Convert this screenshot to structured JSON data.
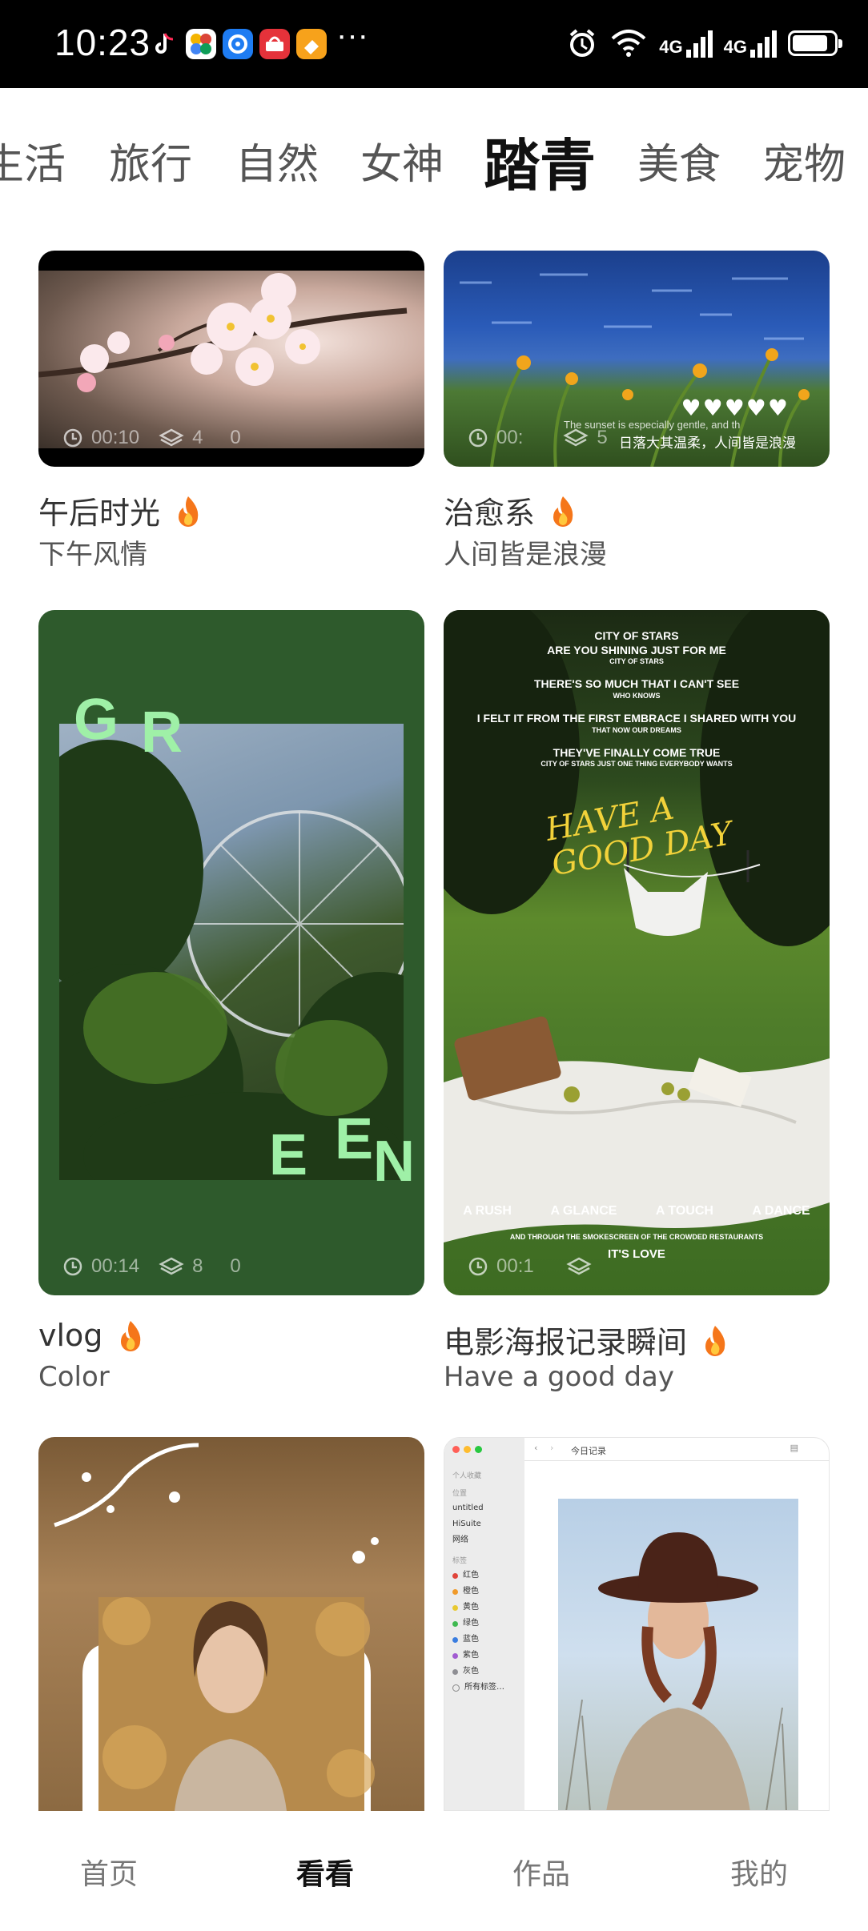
{
  "status_bar": {
    "time": "10:23",
    "more": "···",
    "net1": "4G",
    "net2": "4G",
    "battery_level": 0.85,
    "app_icons": [
      "tiktok-icon",
      "photos-icon",
      "browser-icon",
      "huawei-icon",
      "app-icon"
    ]
  },
  "tabs": [
    {
      "label": "生活"
    },
    {
      "label": "旅行"
    },
    {
      "label": "自然"
    },
    {
      "label": "女神"
    },
    {
      "label": "踏青",
      "active": true
    },
    {
      "label": "美食"
    },
    {
      "label": "宠物"
    }
  ],
  "cards": [
    {
      "title": "午后时光",
      "subtitle": "下午风情",
      "duration": "00:10",
      "layers": "4",
      "count": "0",
      "hot": true
    },
    {
      "title": "治愈系",
      "subtitle": "人间皆是浪漫",
      "duration": "00:",
      "layers": "5",
      "count": "",
      "hot": true,
      "overlay_text": "日落大其温柔，人间皆是浪漫",
      "overlay_small": "The sunset is especially gentle, and the world is romantic",
      "hearts": "♥♥♥♥♥"
    },
    {
      "title": "vlog",
      "subtitle": "Color",
      "duration": "00:14",
      "layers": "8",
      "count": "0",
      "hot": true,
      "letters": [
        "G",
        "R",
        "E",
        "E",
        "N"
      ]
    },
    {
      "title": "电影海报记录瞬间",
      "subtitle": "Have a good day",
      "duration": "00:1",
      "layers": "",
      "count": "",
      "hot": true,
      "poster_lines": [
        "CITY OF STARS",
        "ARE YOU SHINING JUST FOR ME",
        "CITY OF STARS",
        "THERE'S SO MUCH THAT I CAN'T SEE",
        "WHO KNOWS",
        "I FELT IT FROM THE FIRST EMBRACE I SHARED WITH YOU",
        "THAT NOW OUR DREAMS",
        "THEY'VE FINALLY COME TRUE",
        "CITY OF STARS JUST ONE THING EVERYBODY WANTS"
      ],
      "script_text": "HAVE A GOOD DAY",
      "bottom_words": [
        "A RUSH",
        "A GLANCE",
        "A TOUCH",
        "A DANCE"
      ],
      "bottom_line": "AND THROUGH THE SMOKESCREEN OF THE CROWDED RESTAURANTS",
      "love": "IT'S LOVE"
    },
    {
      "title": "",
      "subtitle": ""
    },
    {
      "finder_path": "今日记录",
      "sidebar_heading1": "个人收藏",
      "sidebar_heading2": "位置",
      "sidebar_items": [
        "untitled",
        "HiSuite",
        "网络"
      ],
      "sidebar_heading3": "标签",
      "tags": [
        {
          "name": "红色",
          "color": "#e0443a"
        },
        {
          "name": "橙色",
          "color": "#f09a2a"
        },
        {
          "name": "黄色",
          "color": "#e8c930"
        },
        {
          "name": "绿色",
          "color": "#3fb950"
        },
        {
          "name": "蓝色",
          "color": "#3a7de0"
        },
        {
          "name": "紫色",
          "color": "#a15bd1"
        },
        {
          "name": "灰色",
          "color": "#8e8e93"
        },
        {
          "name": "所有标签…",
          "color": ""
        }
      ]
    }
  ],
  "bottom_nav": [
    {
      "label": "首页"
    },
    {
      "label": "看看",
      "active": true
    },
    {
      "label": "作品"
    },
    {
      "label": "我的"
    }
  ]
}
